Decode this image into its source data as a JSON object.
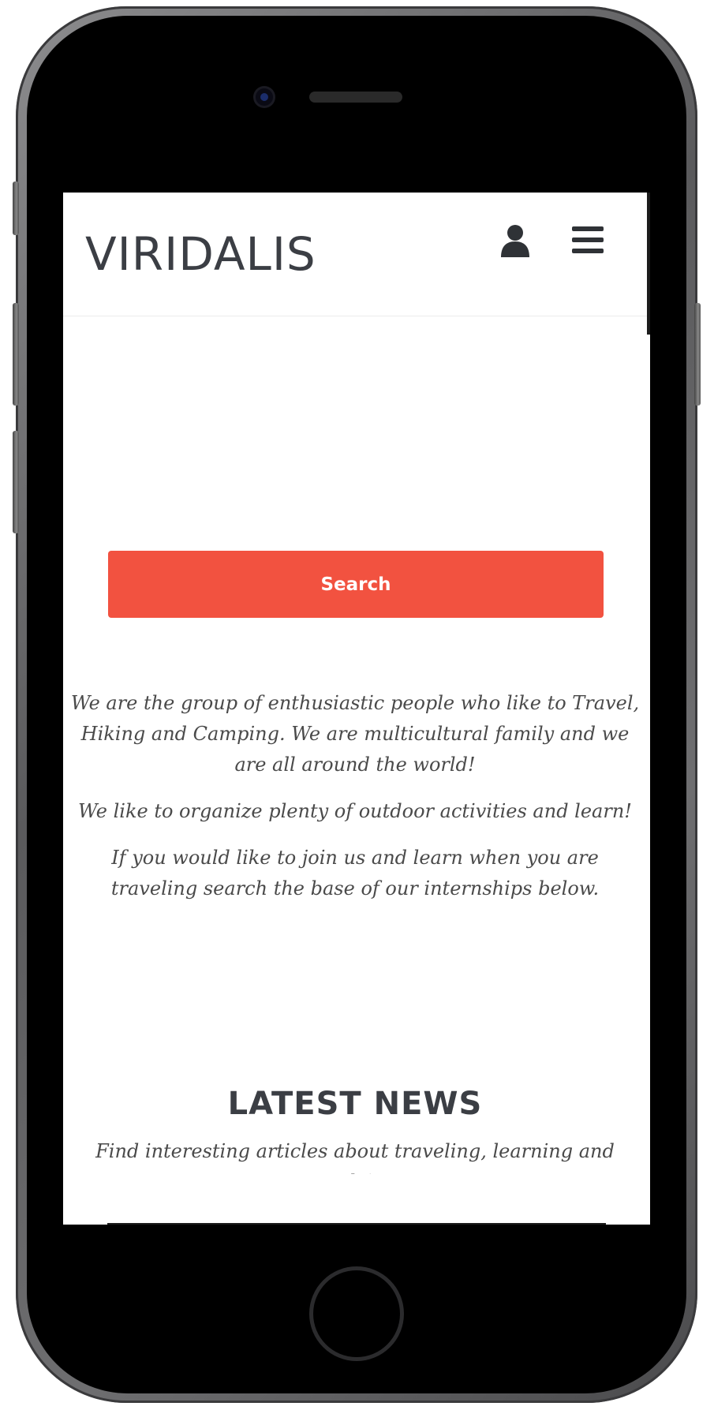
{
  "header": {
    "logo": "VIRIDALIS",
    "user_icon": "user-icon",
    "menu_icon": "hamburger-menu-icon"
  },
  "search": {
    "button_label": "Search"
  },
  "intro": {
    "paragraphs": [
      "We are the group of enthusiastic people who like to Travel, Hiking and Camping.  We are multicultural family and we are all around the world!",
      "We like to organize plenty of outdoor activities and learn!",
      "If you would like to join us and learn when you are traveling search the base of our internships below."
    ]
  },
  "news": {
    "title": "LATEST NEWS",
    "subtitle": "Find interesting articles about traveling, learning and studying"
  },
  "colors": {
    "accent": "#f25240",
    "text_dark": "#3b3e44",
    "text_body": "#4a4a4a"
  }
}
